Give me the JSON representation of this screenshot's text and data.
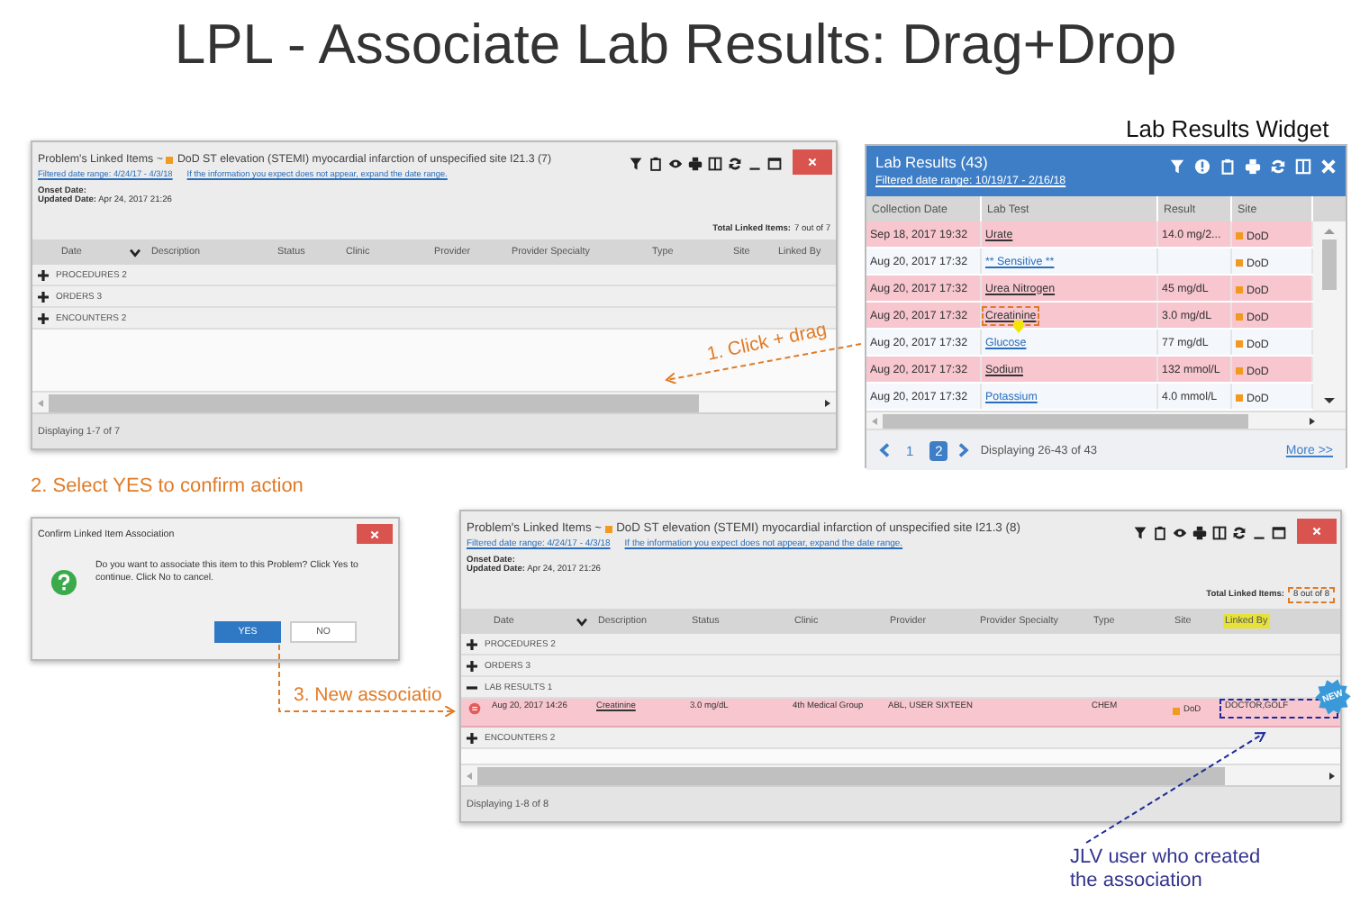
{
  "title": "LPL - Associate Lab Results: Drag+Drop",
  "widget_caption": "Lab Results Widget",
  "step_1": "1. Click + drag",
  "step_2": "2. Select YES to confirm action",
  "step_3": "3. New associatio",
  "note": "JLV user who created the association",
  "linked_panels": [
    {
      "title_prefix": "Problem's Linked Items ~",
      "title": "DoD ST elevation (STEMI) myocardial infarction of unspecified site I21.3 (7)",
      "date_range": "Filtered date range: 4/24/17 - 4/3/18",
      "date_hint": "If the information you expect does not appear, expand the date range.",
      "onset_label": "Onset Date:",
      "updated_label": "Updated Date:",
      "updated_value": "Apr 24, 2017 21:26",
      "total_label": "Total Linked Items:",
      "total_value": "7 out of 7",
      "total_flagged": false,
      "columns": [
        {
          "label": "Date",
          "highlighted": false
        },
        {
          "label": "Description",
          "highlighted": false
        },
        {
          "label": "Status",
          "highlighted": false
        },
        {
          "label": "Clinic",
          "highlighted": false
        },
        {
          "label": "Provider",
          "highlighted": false
        },
        {
          "label": "Provider Specialty",
          "highlighted": false
        },
        {
          "label": "Type",
          "highlighted": false
        },
        {
          "label": "Site",
          "highlighted": false
        },
        {
          "label": "Linked By",
          "highlighted": false
        }
      ],
      "groups": [
        {
          "label": "PROCEDURES 2",
          "expanded": false
        },
        {
          "label": "ORDERS 3",
          "expanded": false
        },
        {
          "label": "ENCOUNTERS 2",
          "expanded": false
        }
      ],
      "footer": "Displaying 1-7 of 7"
    },
    {
      "title_prefix": "Problem's Linked Items ~",
      "title": "DoD ST elevation (STEMI) myocardial infarction of unspecified site I21.3 (8)",
      "date_range": "Filtered date range: 4/24/17 - 4/3/18",
      "date_hint": "If the information you expect does not appear, expand the date range.",
      "onset_label": "Onset Date:",
      "updated_label": "Updated Date:",
      "updated_value": "Apr 24, 2017 21:26",
      "total_label": "Total Linked Items:",
      "total_value": "8 out of 8",
      "total_flagged": true,
      "columns": [
        {
          "label": "Date",
          "highlighted": false
        },
        {
          "label": "Description",
          "highlighted": false
        },
        {
          "label": "Status",
          "highlighted": false
        },
        {
          "label": "Clinic",
          "highlighted": false
        },
        {
          "label": "Provider",
          "highlighted": false
        },
        {
          "label": "Provider Specialty",
          "highlighted": false
        },
        {
          "label": "Type",
          "highlighted": false
        },
        {
          "label": "Site",
          "highlighted": false
        },
        {
          "label": "Linked By",
          "highlighted": true
        }
      ],
      "groups": [
        {
          "label": "PROCEDURES 2",
          "expanded": false
        },
        {
          "label": "ORDERS 3",
          "expanded": false
        },
        {
          "label": "LAB RESULTS 1",
          "expanded": true,
          "rows": [
            {
              "date": "Aug 20, 2017 14:26",
              "description": "Creatinine",
              "status": "3.0 mg/dL",
              "clinic": "4th Medical Group",
              "provider": "ABL, USER SIXTEEN",
              "type": "CHEM",
              "site": "DoD",
              "linked_by": "DOCTOR,GOLF",
              "linked_by_flagged": true,
              "badge": "NEW"
            }
          ]
        },
        {
          "label": "ENCOUNTERS 2",
          "expanded": false
        }
      ],
      "footer": "Displaying 1-8 of 8"
    }
  ],
  "lab_widget": {
    "title": "Lab Results (43)",
    "date_range": "Filtered date range: 10/19/17 - 2/16/18",
    "columns": [
      "Collection Date",
      "Lab Test",
      "Result",
      "Site"
    ],
    "rows": [
      {
        "date": "Sep 18, 2017 19:32",
        "test": "Urate",
        "result": "14.0 mg/2...",
        "site": "DoD",
        "abnormal": true,
        "dragged": false
      },
      {
        "date": "Aug 20, 2017 17:32",
        "test": "** Sensitive **",
        "site": "DoD",
        "abnormal": false,
        "dragged": false
      },
      {
        "date": "Aug 20, 2017 17:32",
        "test": "Urea Nitrogen",
        "result": "45 mg/dL",
        "site": "DoD",
        "abnormal": true,
        "dragged": false
      },
      {
        "date": "Aug 20, 2017 17:32",
        "test": "Creatinine",
        "result": "3.0 mg/dL",
        "site": "DoD",
        "abnormal": true,
        "dragged": true
      },
      {
        "date": "Aug 20, 2017 17:32",
        "test": "Glucose",
        "result": "77 mg/dL",
        "site": "DoD",
        "abnormal": false,
        "dragged": false
      },
      {
        "date": "Aug 20, 2017 17:32",
        "test": "Sodium",
        "result": "132 mmol/L",
        "site": "DoD",
        "abnormal": true,
        "dragged": false
      },
      {
        "date": "Aug 20, 2017 17:32",
        "test": "Potassium",
        "result": "4.0 mmol/L",
        "site": "DoD",
        "abnormal": false,
        "dragged": false
      }
    ],
    "pages": [
      {
        "label": "1",
        "selected": false
      },
      {
        "label": "2",
        "selected": true
      }
    ],
    "status": "Displaying 26-43 of 43",
    "more": "More >>"
  },
  "dialog": {
    "title": "Confirm Linked Item Association",
    "message": "Do you want to associate this item to this Problem? Click Yes to continue. Click No to cancel.",
    "buttons": [
      {
        "label": "YES",
        "primary": true
      },
      {
        "label": "NO",
        "primary": false
      }
    ]
  }
}
